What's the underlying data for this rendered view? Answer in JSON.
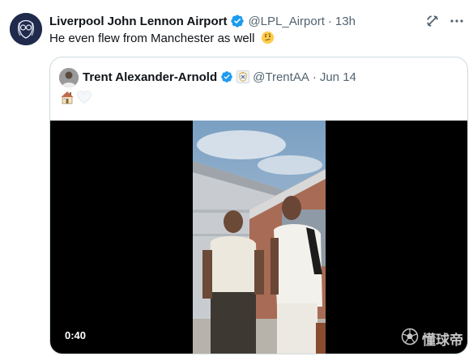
{
  "tweet": {
    "author_name": "Liverpool John Lennon Airport",
    "handle": "@LPL_Airport",
    "separator": "·",
    "time": "13h",
    "text": "He even flew from Manchester as well",
    "emoji": "thinking-face-icon"
  },
  "quoted_tweet": {
    "author_name": "Trent Alexander-Arnold",
    "handle": "@TrentAA",
    "separator": "·",
    "date": "Jun 14",
    "emojis": [
      "house-icon",
      "white-heart-icon"
    ],
    "video": {
      "duration": "0:40"
    }
  },
  "watermark": {
    "text": "懂球帝",
    "icon": "football-icon"
  },
  "colors": {
    "verified": "#1d9bf0",
    "secondary_text": "#536471",
    "border": "#cfd9de",
    "video_bg": "#000000"
  }
}
